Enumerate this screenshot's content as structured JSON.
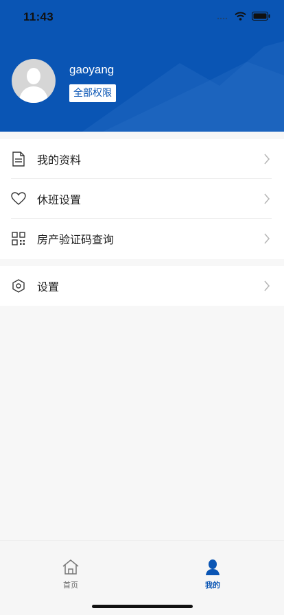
{
  "status_bar": {
    "time": "11:43"
  },
  "profile": {
    "username": "gaoyang",
    "permission_badge": "全部权限"
  },
  "menu": {
    "group1": [
      {
        "label": "我的资料",
        "icon": "document-icon"
      },
      {
        "label": "休班设置",
        "icon": "heart-icon"
      },
      {
        "label": "房产验证码查询",
        "icon": "qrcode-icon"
      }
    ],
    "group2": [
      {
        "label": "设置",
        "icon": "settings-hexagon-icon"
      }
    ]
  },
  "tabbar": {
    "home_label": "首页",
    "mine_label": "我的"
  },
  "colors": {
    "brand_blue": "#0a55b4",
    "background": "#f7f7f7"
  }
}
